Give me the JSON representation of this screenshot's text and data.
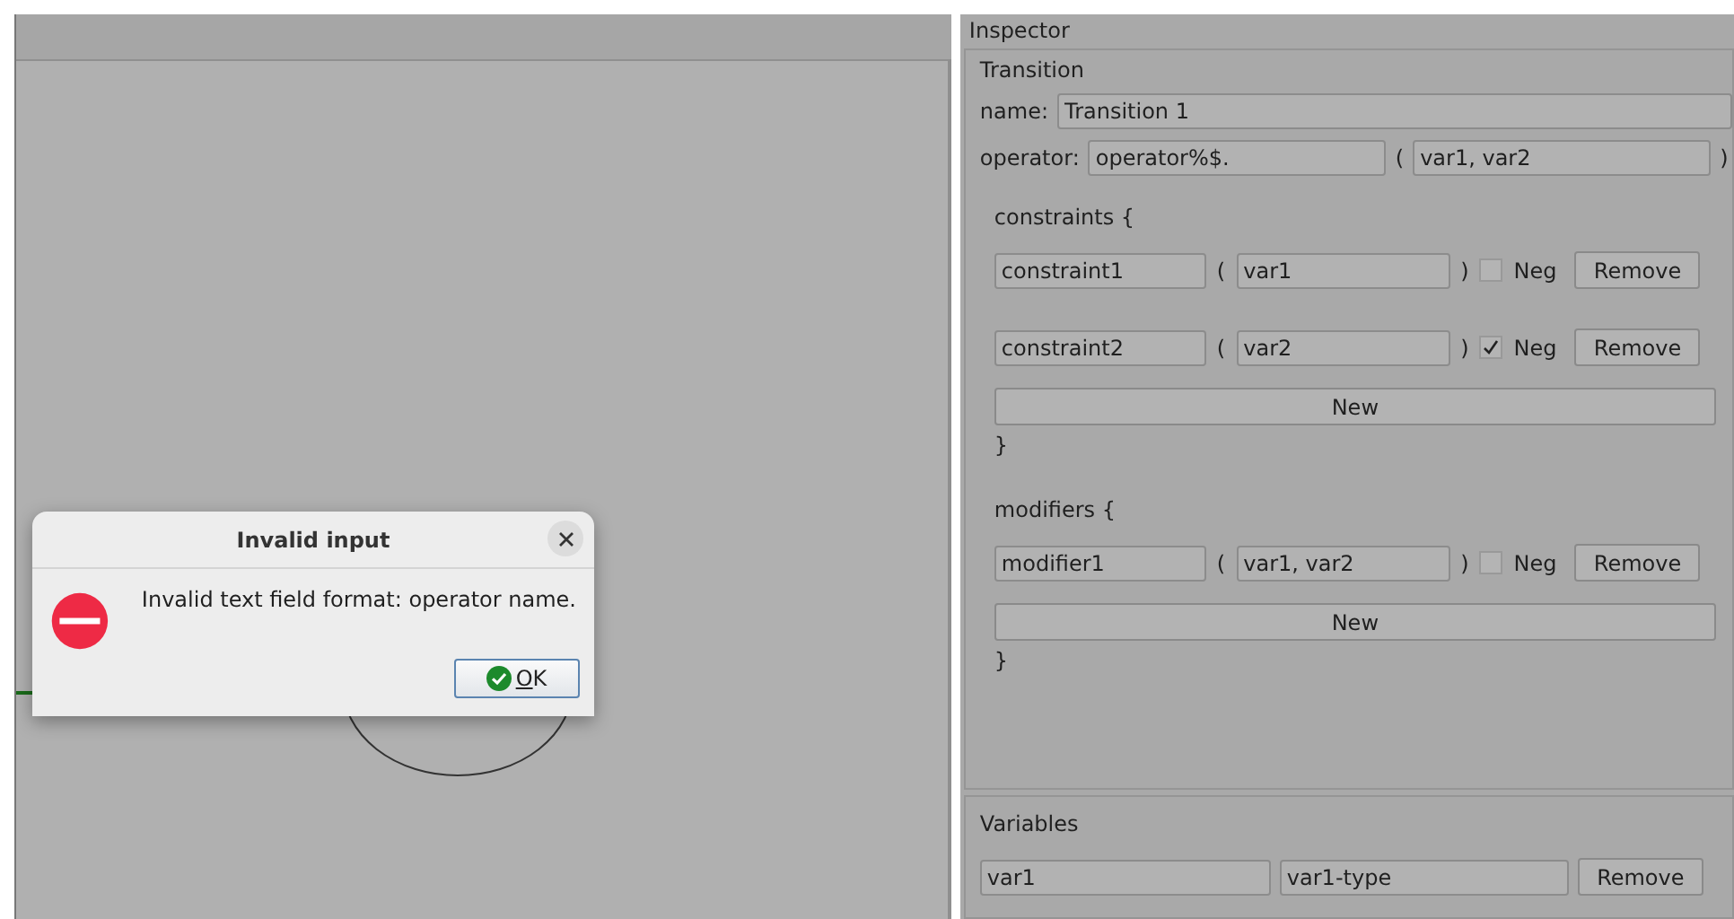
{
  "dialog": {
    "title": "Invalid input",
    "message": "Invalid text field format: operator name.",
    "ok_button": "OK"
  },
  "inspector": {
    "title": "Inspector",
    "transition": {
      "title": "Transition",
      "name_label": "name:",
      "name_value": "Transition 1",
      "operator_label": "operator:",
      "operator_value": "operator%$.",
      "open_paren": "(",
      "args_value": "var1, var2",
      "close_paren": ")"
    },
    "constraints": {
      "header": "constraints {",
      "rows": [
        {
          "name": "constraint1",
          "open_paren": "(",
          "args": "var1",
          "close_paren": ")",
          "neg_label": "Neg",
          "neg_checked": false,
          "remove_button": "Remove"
        },
        {
          "name": "constraint2",
          "open_paren": "(",
          "args": "var2",
          "close_paren": ")",
          "neg_label": "Neg",
          "neg_checked": true,
          "remove_button": "Remove"
        }
      ],
      "new_button": "New",
      "closing": "}"
    },
    "modifiers": {
      "header": "modifiers {",
      "rows": [
        {
          "name": "modifier1",
          "open_paren": "(",
          "args": "var1, var2",
          "close_paren": ")",
          "neg_label": "Neg",
          "neg_checked": false,
          "remove_button": "Remove"
        }
      ],
      "new_button": "New",
      "closing": "}"
    }
  },
  "variables": {
    "title": "Variables",
    "rows": [
      {
        "name": "var1",
        "type": "var1-type",
        "remove_button": "Remove"
      }
    ]
  }
}
